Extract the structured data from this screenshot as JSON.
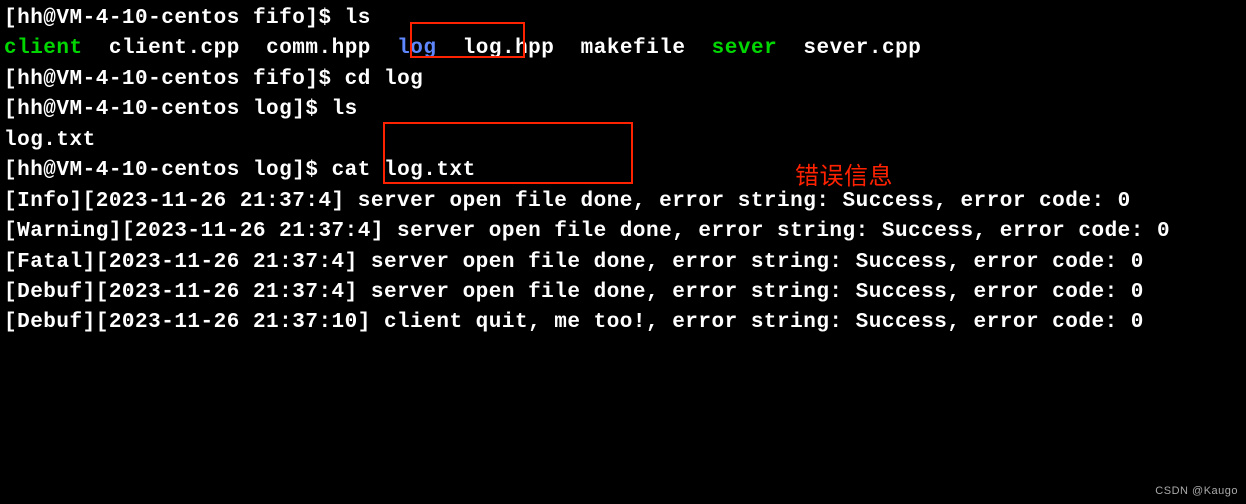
{
  "prompts": {
    "fifo": "[hh@VM-4-10-centos fifo]$ ",
    "log": "[hh@VM-4-10-centos log]$ "
  },
  "cmds": {
    "ls": "ls",
    "cdlog": "cd log",
    "cat": "cat log.txt"
  },
  "ls_output": {
    "client": "client",
    "client_cpp": "client.cpp",
    "comm_hpp": "comm.hpp",
    "log": "log",
    "log_hpp": "log.hpp",
    "makefile": "makefile",
    "sever": "sever",
    "sever_cpp": "sever.cpp"
  },
  "ls_log_output": "log.txt",
  "annotation": "错误信息",
  "log_lines": [
    "[Info][2023-11-26 21:37:4] server open file done, error string: Success, error code: 0",
    "[Warning][2023-11-26 21:37:4] server open file done, error string: Success, error code: 0",
    "[Fatal][2023-11-26 21:37:4] server open file done, error string: Success, error code: 0",
    "[Debuf][2023-11-26 21:37:4] server open file done, error string: Success, error code: 0",
    "[Debuf][2023-11-26 21:37:10] client quit, me too!, error string: Success, error code: 0"
  ],
  "watermark": "CSDN @Kaugo"
}
